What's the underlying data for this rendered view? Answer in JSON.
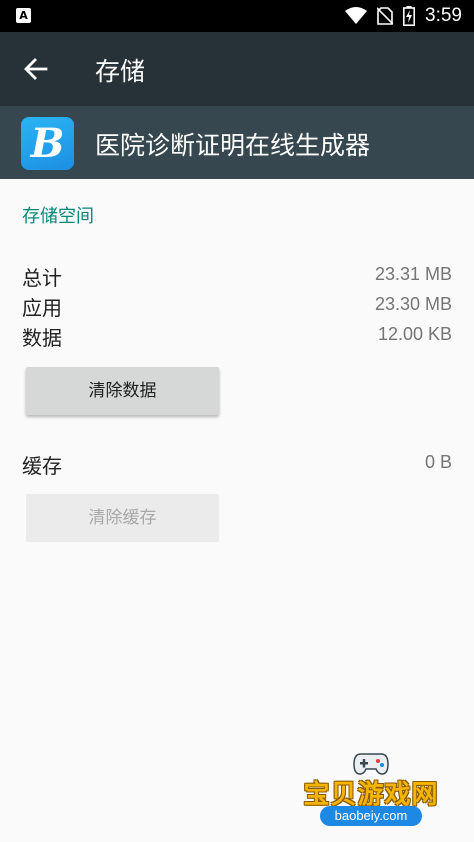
{
  "status_bar": {
    "time": "3:59",
    "left_icon": "A",
    "icons": [
      "wifi-icon",
      "no-sim-icon",
      "battery-charging-icon"
    ]
  },
  "toolbar": {
    "title": "存储",
    "back_icon": "arrow-back-icon"
  },
  "app": {
    "name": "医院诊断证明在线生成器",
    "icon_letter": "B",
    "icon_color": "#1d8fe3"
  },
  "storage": {
    "section_title": "存储空间",
    "rows": [
      {
        "label": "总计",
        "value": "23.31 MB"
      },
      {
        "label": "应用",
        "value": "23.30 MB"
      },
      {
        "label": "数据",
        "value": "12.00 KB"
      }
    ],
    "clear_data_label": "清除数据"
  },
  "cache": {
    "label": "缓存",
    "value": "0 B",
    "clear_cache_label": "清除缓存"
  },
  "watermark": {
    "title": "宝贝游戏网",
    "url": "baobeiy.com"
  },
  "colors": {
    "toolbar": "#263238",
    "app_header": "#37474f",
    "accent": "#00897b"
  }
}
